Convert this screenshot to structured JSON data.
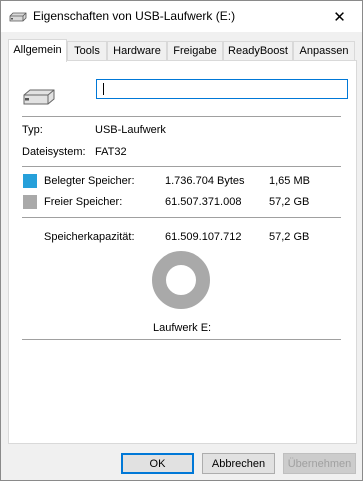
{
  "window": {
    "title": "Eigenschaften von USB-Laufwerk (E:)",
    "close_symbol": "✕"
  },
  "tabs": [
    {
      "label": "Allgemein",
      "active": true
    },
    {
      "label": "Tools"
    },
    {
      "label": "Hardware"
    },
    {
      "label": "Freigabe"
    },
    {
      "label": "ReadyBoost"
    },
    {
      "label": "Anpassen"
    }
  ],
  "general": {
    "name_value": "",
    "type_label": "Typ:",
    "type_value": "USB-Laufwerk",
    "fs_label": "Dateisystem:",
    "fs_value": "FAT32",
    "used": {
      "label": "Belegter Speicher:",
      "bytes": "1.736.704 Bytes",
      "size": "1,65 MB",
      "color": "#26a0da"
    },
    "free": {
      "label": "Freier Speicher:",
      "bytes": "61.507.371.008",
      "size": "57,2 GB",
      "color": "#a9a9a9"
    },
    "capacity": {
      "label": "Speicherkapazität:",
      "bytes": "61.509.107.712",
      "size": "57,2 GB"
    },
    "drive_label": "Laufwerk E:",
    "used_fraction": 2.82e-05
  },
  "buttons": {
    "ok": "OK",
    "cancel": "Abbrechen",
    "apply": "Übernehmen"
  },
  "icons": [
    "usb-drive-icon",
    "close-icon"
  ]
}
